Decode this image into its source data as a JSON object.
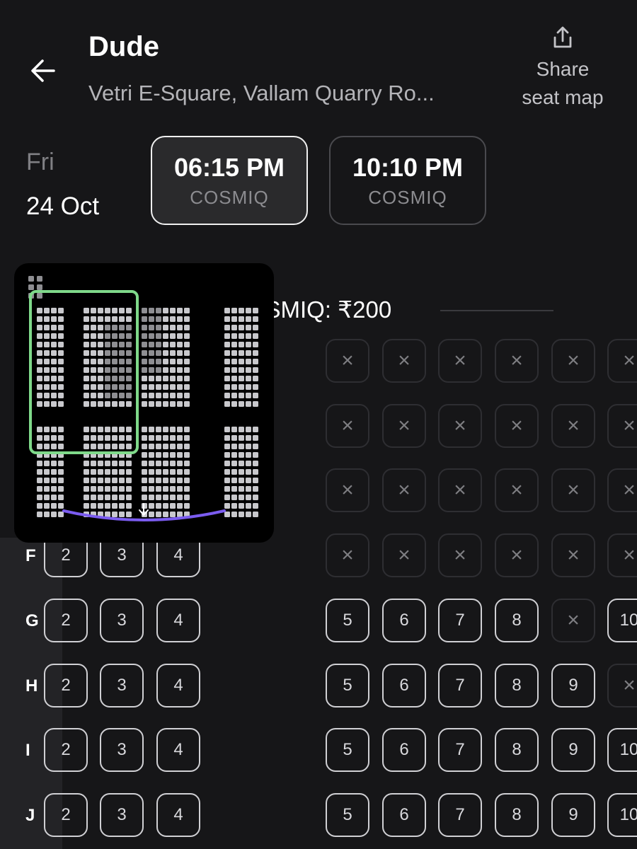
{
  "header": {
    "title": "Dude",
    "subtitle": "Vetri E-Square, Vallam Quarry Ro...",
    "share_label": "Share\nseat map"
  },
  "date": {
    "day": "Fri",
    "date": "24 Oct"
  },
  "showtimes": [
    {
      "time": "06:15 PM",
      "format": "COSMIQ",
      "selected": true
    },
    {
      "time": "10:10 PM",
      "format": "COSMIQ",
      "selected": false
    }
  ],
  "price_category": {
    "label": "COSMIQ: ₹200"
  },
  "rows": [
    {
      "label": "F",
      "left": [
        "2",
        "3",
        "4"
      ],
      "right": [
        "×",
        "×",
        "×",
        "×",
        "×",
        "×"
      ]
    },
    {
      "label": "G",
      "left": [
        "2",
        "3",
        "4"
      ],
      "right": [
        "5",
        "6",
        "7",
        "8",
        "×",
        "10"
      ]
    },
    {
      "label": "H",
      "left": [
        "2",
        "3",
        "4"
      ],
      "right": [
        "5",
        "6",
        "7",
        "8",
        "9",
        "×"
      ]
    },
    {
      "label": "I",
      "left": [
        "2",
        "3",
        "4"
      ],
      "right": [
        "5",
        "6",
        "7",
        "8",
        "9",
        "10"
      ]
    },
    {
      "label": "J",
      "left": [
        "2",
        "3",
        "4"
      ],
      "right": [
        "5",
        "6",
        "7",
        "8",
        "9",
        "10"
      ]
    }
  ],
  "upper_rows": [
    {
      "right": [
        "×",
        "×",
        "×",
        "×",
        "×",
        "×"
      ]
    },
    {
      "right": [
        "×",
        "×",
        "×",
        "×",
        "×",
        "×"
      ]
    },
    {
      "right": [
        "×",
        "×",
        "×",
        "×",
        "×",
        "×"
      ]
    }
  ],
  "colors": {
    "background": "#161618",
    "minimap_viewport": "#7fd98a",
    "screen_arc": "#7b5cf0"
  },
  "icons": {
    "back": "arrow-left-icon",
    "share": "share-upload-icon",
    "sold": "close-icon",
    "screen": "arrow-down-icon"
  }
}
